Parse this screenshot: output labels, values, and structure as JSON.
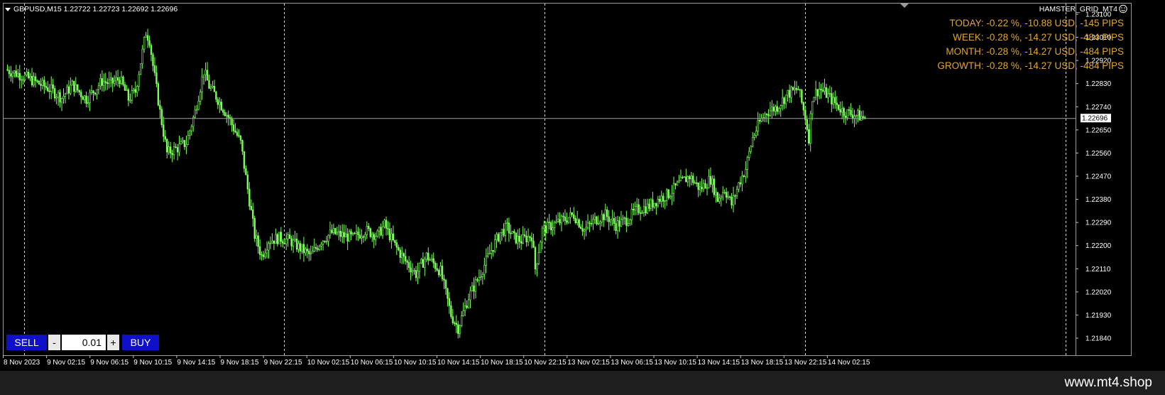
{
  "header": {
    "symbol_line": "GBPUSD,M15  1.22722 1.22723 1.22692 1.22696",
    "indicator_name": "HAMSTER_GRID_MT4",
    "smiley_icon": "smiley-icon"
  },
  "stats": {
    "today": "TODAY: -0.22 %, -10.88 USD, -145 PIPS",
    "week": "WEEK: -0.28 %, -14.27 USD, -484 PIPS",
    "month": "MONTH: -0.28 %, -14.27 USD, -484 PIPS",
    "growth": "GROWTH: -0.28 %, -14.27 USD, -484 PIPS"
  },
  "trade_panel": {
    "sell_label": "SELL",
    "minus_label": "-",
    "lot_value": "0.01",
    "plus_label": "+",
    "buy_label": "BUY"
  },
  "watermark": "www.mt4.shop",
  "colors": {
    "background": "#000000",
    "candle": "#7cff5a",
    "stats_text": "#e0a530",
    "axis": "#c0c0c0",
    "trade_button": "#1010c8"
  },
  "chart_data": {
    "type": "candlestick",
    "symbol": "GBPUSD",
    "timeframe": "M15",
    "current_price": "1.22696",
    "ylim": [
      1.218,
      1.2315
    ],
    "y_ticks": [
      "1.23100",
      "1.23010",
      "1.22920",
      "1.22830",
      "1.22740",
      "1.22650",
      "1.22560",
      "1.22470",
      "1.22380",
      "1.22290",
      "1.22200",
      "1.22110",
      "1.22020",
      "1.21930",
      "1.21840"
    ],
    "x_labels": [
      "8 Nov 2023",
      "9 Nov 02:15",
      "9 Nov 06:15",
      "9 Nov 10:15",
      "9 Nov 14:15",
      "9 Nov 18:15",
      "9 Nov 22:15",
      "10 Nov 02:15",
      "10 Nov 06:15",
      "10 Nov 10:15",
      "10 Nov 14:15",
      "10 Nov 18:15",
      "10 Nov 22:15",
      "13 Nov 02:15",
      "13 Nov 06:15",
      "13 Nov 10:15",
      "13 Nov 14:15",
      "13 Nov 18:15",
      "13 Nov 22:15",
      "14 Nov 02:15"
    ],
    "price_path": [
      [
        0,
        1.22885
      ],
      [
        10,
        1.2286
      ],
      [
        25,
        1.2281
      ],
      [
        32,
        1.22775
      ],
      [
        38,
        1.22825
      ],
      [
        46,
        1.2277
      ],
      [
        50,
        1.228
      ],
      [
        55,
        1.2284
      ],
      [
        60,
        1.2283
      ],
      [
        65,
        1.2285
      ],
      [
        70,
        1.2277
      ],
      [
        74,
        1.228
      ],
      [
        80,
        1.2303
      ],
      [
        82,
        1.23
      ],
      [
        84,
        1.229
      ],
      [
        88,
        1.2272
      ],
      [
        92,
        1.2256
      ],
      [
        98,
        1.2258
      ],
      [
        103,
        1.226
      ],
      [
        108,
        1.2272
      ],
      [
        113,
        1.2288
      ],
      [
        116,
        1.2282
      ],
      [
        120,
        1.2278
      ],
      [
        127,
        1.227
      ],
      [
        134,
        1.226
      ],
      [
        138,
        1.2242
      ],
      [
        142,
        1.2224
      ],
      [
        146,
        1.2216
      ],
      [
        150,
        1.2222
      ],
      [
        156,
        1.2223
      ],
      [
        162,
        1.2222
      ],
      [
        168,
        1.2219
      ],
      [
        174,
        1.2216
      ],
      [
        180,
        1.2222
      ],
      [
        186,
        1.2225
      ],
      [
        192,
        1.2224
      ],
      [
        198,
        1.2223
      ],
      [
        205,
        1.2226
      ],
      [
        212,
        1.2224
      ],
      [
        216,
        1.2228
      ],
      [
        222,
        1.222
      ],
      [
        228,
        1.2214
      ],
      [
        234,
        1.2209
      ],
      [
        240,
        1.2216
      ],
      [
        248,
        1.221
      ],
      [
        254,
        1.2193
      ],
      [
        258,
        1.2188
      ],
      [
        264,
        1.22
      ],
      [
        270,
        1.2208
      ],
      [
        276,
        1.2217
      ],
      [
        282,
        1.2225
      ],
      [
        286,
        1.2227
      ],
      [
        290,
        1.2223
      ],
      [
        294,
        1.2222
      ],
      [
        300,
        1.2224
      ],
      [
        302,
        1.2211
      ],
      [
        306,
        1.2226
      ],
      [
        312,
        1.2228
      ],
      [
        318,
        1.223
      ],
      [
        324,
        1.2232
      ],
      [
        330,
        1.2226
      ],
      [
        336,
        1.223
      ],
      [
        342,
        1.2232
      ],
      [
        348,
        1.2228
      ],
      [
        354,
        1.223
      ],
      [
        360,
        1.2234
      ],
      [
        366,
        1.2235
      ],
      [
        372,
        1.2238
      ],
      [
        378,
        1.224
      ],
      [
        384,
        1.2244
      ],
      [
        390,
        1.2247
      ],
      [
        396,
        1.2242
      ],
      [
        402,
        1.2246
      ],
      [
        406,
        1.2238
      ],
      [
        410,
        1.2242
      ],
      [
        414,
        1.2236
      ],
      [
        418,
        1.2244
      ],
      [
        422,
        1.225
      ],
      [
        426,
        1.2262
      ],
      [
        430,
        1.2268
      ],
      [
        434,
        1.2272
      ],
      [
        440,
        1.2274
      ],
      [
        446,
        1.2279
      ],
      [
        452,
        1.2281
      ],
      [
        456,
        1.227
      ],
      [
        458,
        1.2262
      ],
      [
        460,
        1.2278
      ],
      [
        464,
        1.2281
      ],
      [
        468,
        1.2279
      ],
      [
        472,
        1.2276
      ],
      [
        478,
        1.2272
      ],
      [
        484,
        1.2271
      ],
      [
        490,
        1.22696
      ]
    ]
  }
}
